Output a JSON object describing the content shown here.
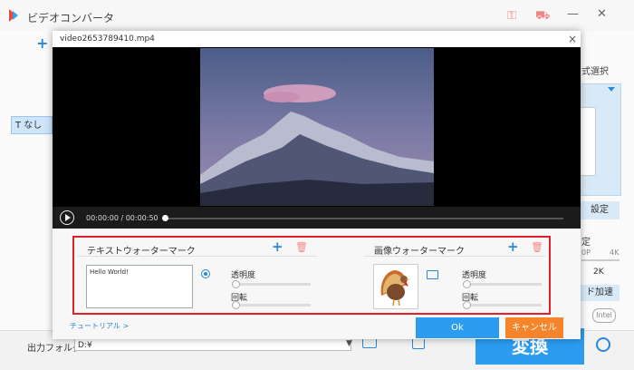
{
  "app": {
    "title": "ビデオコンバータ"
  },
  "left_panel": {
    "add_label": "+",
    "subtitle_chip": "なし"
  },
  "right_panel": {
    "format_label": "式選択",
    "settings_label": "設定",
    "section_label": "定",
    "resolution": "2K",
    "res_small_1": "0P",
    "res_small_2": "4K",
    "speed_label": "ド加速",
    "intel_label": "Intel"
  },
  "bottom": {
    "output_label": "出力フォルダ：",
    "output_path": "D:¥",
    "convert_label": "変換"
  },
  "dialog": {
    "title": "video2653789410.mp4",
    "close": "×",
    "player": {
      "time": "00:00:00 / 00:00:50"
    },
    "text_watermark": {
      "title": "テキストウォーターマーク",
      "text": "Hello World!",
      "opacity_label": "透明度",
      "rotate_label": "回転"
    },
    "image_watermark": {
      "title": "画像ウォーターマーク",
      "opacity_label": "透明度",
      "rotate_label": "回転"
    },
    "tutorial_link": "チュートリアル >",
    "ok_label": "Ok",
    "cancel_label": "キャンセル"
  },
  "colors": {
    "accent": "#2b9cf0",
    "cancel": "#f5842a",
    "highlight_frame": "#e0202a"
  }
}
